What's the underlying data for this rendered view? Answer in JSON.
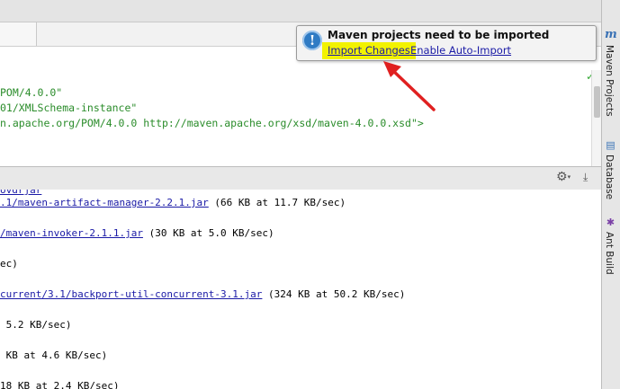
{
  "notification": {
    "title": "Maven projects need to be imported",
    "import_changes": "Import Changes",
    "enable_auto_import": "Enable Auto-Import",
    "info_glyph": "!"
  },
  "editor": {
    "lines": [
      {
        "text": "POM/4.0.0\"",
        "cls": "str"
      },
      {
        "text": "01/XMLSchema-instance\"",
        "cls": "str"
      },
      {
        "text": "n.apache.org/POM/4.0.0 http://maven.apache.org/xsd/maven-4.0.0.xsd\">",
        "cls": "str"
      }
    ]
  },
  "console": {
    "partial_top": "ovdrjar",
    "lines": [
      {
        "link": ".1/maven-artifact-manager-2.2.1.jar",
        "rest": " (66 KB at 11.7 KB/sec)"
      },
      {
        "link": "/maven-invoker-2.1.1.jar",
        "rest": " (30 KB at 5.0 KB/sec)"
      },
      {
        "link": "",
        "rest": "ec)"
      },
      {
        "link": "current/3.1/backport-util-concurrent-3.1.jar",
        "rest": " (324 KB at 50.2 KB/sec)"
      },
      {
        "link": "",
        "rest": " 5.2 KB/sec)"
      },
      {
        "link": "",
        "rest": " KB at 4.6 KB/sec)"
      },
      {
        "link": "",
        "rest": "18 KB at 2.4 KB/sec)"
      }
    ]
  },
  "sidebar": {
    "maven": {
      "label": "Maven Projects",
      "icon": "maven-icon",
      "glyph": "m"
    },
    "database": {
      "label": "Database",
      "icon": "database-icon",
      "glyph": "▤"
    },
    "ant": {
      "label": "Ant Build",
      "icon": "ant-icon",
      "glyph": "✱"
    }
  },
  "toolbar": {
    "gear_glyph": "⚙",
    "caret_glyph": "▾",
    "pin_glyph": "⤓",
    "check_glyph": "✓"
  },
  "colors": {
    "string_green": "#2a8c2a",
    "link_blue": "#1a1aa6",
    "highlight_yellow": "#f2f200",
    "arrow_red": "#e02020",
    "info_blue": "#2f7bc4"
  }
}
